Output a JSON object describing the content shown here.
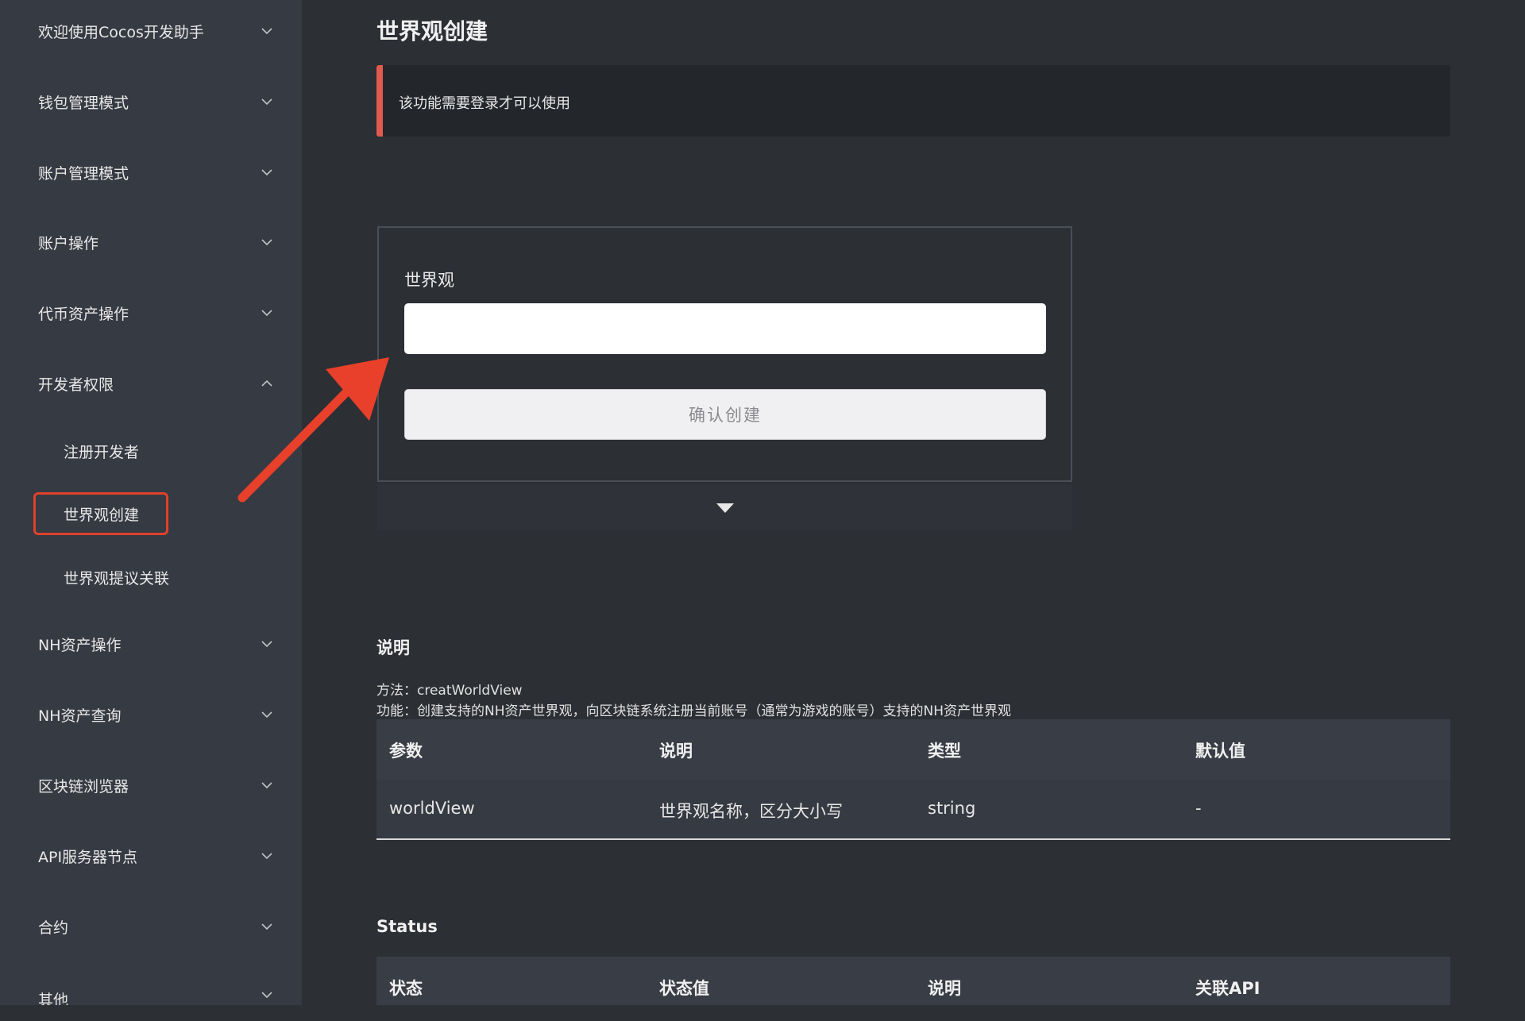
{
  "sidebar": {
    "items": [
      {
        "label": "欢迎使用Cocos开发助手",
        "expanded": false
      },
      {
        "label": "钱包管理模式",
        "expanded": false
      },
      {
        "label": "账户管理模式",
        "expanded": false
      },
      {
        "label": "账户操作",
        "expanded": false
      },
      {
        "label": "代币资产操作",
        "expanded": false
      },
      {
        "label": "开发者权限",
        "expanded": true
      },
      {
        "label": "NH资产操作",
        "expanded": false
      },
      {
        "label": "NH资产查询",
        "expanded": false
      },
      {
        "label": "区块链浏览器",
        "expanded": false
      },
      {
        "label": "API服务器节点",
        "expanded": false
      },
      {
        "label": "合约",
        "expanded": false
      },
      {
        "label": "其他",
        "expanded": false
      }
    ],
    "sub_items": [
      {
        "label": "注册开发者"
      },
      {
        "label": "世界观创建",
        "active": true
      },
      {
        "label": "世界观提议关联"
      }
    ]
  },
  "main": {
    "title": "世界观创建",
    "notice": "该功能需要登录才可以使用",
    "form": {
      "field_label": "世界观",
      "field_value": "",
      "confirm_label": "确认创建"
    },
    "description": {
      "title": "说明",
      "method_line": "方法：creatWorldView",
      "function_line": "功能：创建支持的NH资产世界观，向区块链系统注册当前账号（通常为游戏的账号）支持的NH资产世界观"
    },
    "params_table": {
      "headers": [
        "参数",
        "说明",
        "类型",
        "默认值"
      ],
      "rows": [
        [
          "worldView",
          "世界观名称，区分大小写",
          "string",
          "-"
        ]
      ]
    },
    "status": {
      "title": "Status",
      "headers": [
        "状态",
        "状态值",
        "说明",
        "关联API"
      ]
    }
  },
  "colors": {
    "sidebar_bg": "#363a42",
    "content_bg": "#2c2f34",
    "accent_red": "#e0412c",
    "notice_border": "#e05a4f"
  }
}
